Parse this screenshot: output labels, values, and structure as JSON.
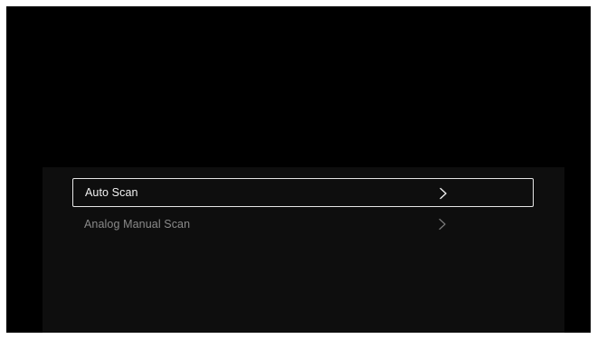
{
  "scan_menu": {
    "items": [
      {
        "label": "Auto Scan",
        "icon": "chevron-right-icon",
        "focused": true
      },
      {
        "label": "Analog Manual Scan",
        "icon": "chevron-right-icon",
        "focused": false
      }
    ]
  },
  "colors": {
    "background": "#000000",
    "panel": "#0e0e0e",
    "focus_border": "#e6e6e6",
    "focused_text": "#f2f2f2",
    "unfocused_text": "#8a8a8a"
  }
}
